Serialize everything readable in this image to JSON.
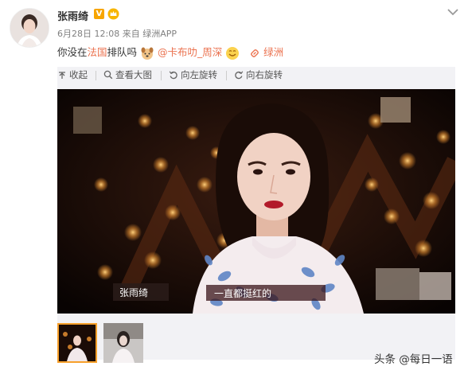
{
  "user": {
    "name": "张雨绮",
    "verified_badge": "V"
  },
  "meta": {
    "date": "6月28日 12:08",
    "from": "来自",
    "source": "绿洲APP"
  },
  "post": {
    "part1": "你没在",
    "highlight": "法国",
    "part2": "排队吗",
    "mention": "@卡布叻_周深",
    "location": "绿洲"
  },
  "toolbar": {
    "collapse": "收起",
    "view_large": "查看大图",
    "rotate_left": "向左旋转",
    "rotate_right": "向右旋转"
  },
  "photo": {
    "caption_name": "张雨绮",
    "subtitle": "一直都挺红的"
  },
  "watermark": {
    "prefix": "头条",
    "handle": "@每日一语"
  },
  "colors": {
    "accent": "#eb7350",
    "badge": "#f7a500",
    "thumb_selected_border": "#f7a02b"
  }
}
